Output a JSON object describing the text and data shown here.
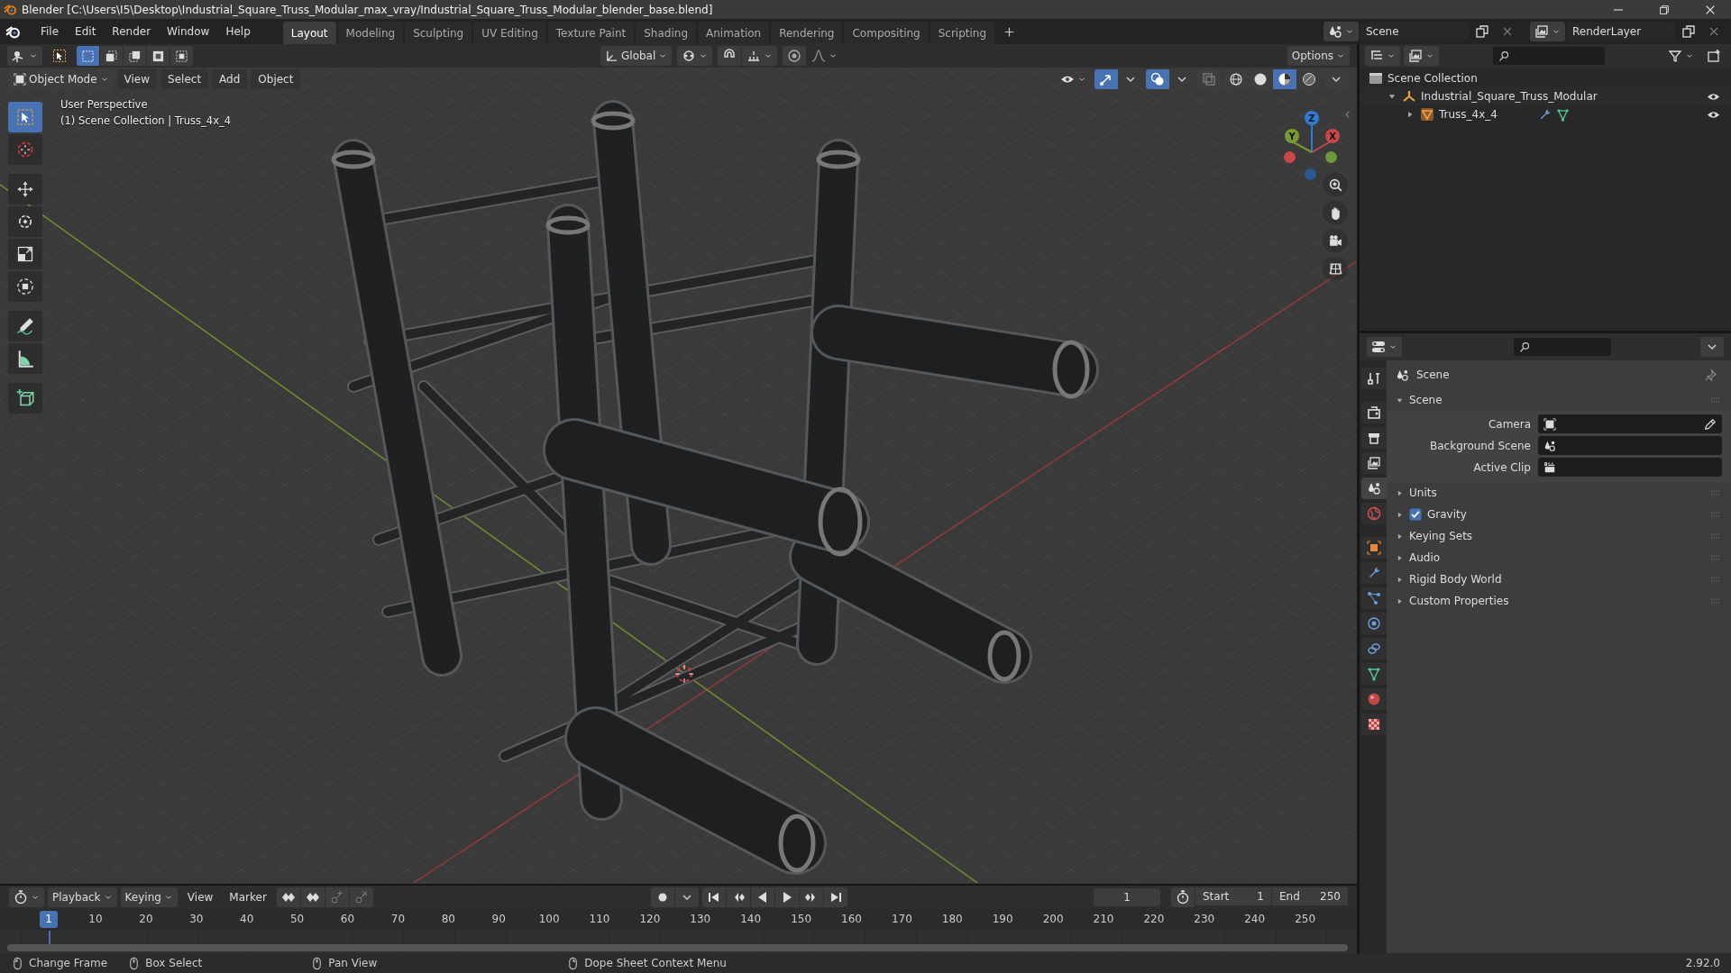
{
  "window": {
    "title": "Blender [C:\\Users\\I5\\Desktop\\Industrial_Square_Truss_Modular_max_vray/Industrial_Square_Truss_Modular_blender_base.blend]"
  },
  "menu": [
    "File",
    "Edit",
    "Render",
    "Window",
    "Help"
  ],
  "workspaces": [
    {
      "label": "Layout",
      "selected": true
    },
    {
      "label": "Modeling",
      "selected": false
    },
    {
      "label": "Sculpting",
      "selected": false
    },
    {
      "label": "UV Editing",
      "selected": false
    },
    {
      "label": "Texture Paint",
      "selected": false
    },
    {
      "label": "Shading",
      "selected": false
    },
    {
      "label": "Animation",
      "selected": false
    },
    {
      "label": "Rendering",
      "selected": false
    },
    {
      "label": "Compositing",
      "selected": false
    },
    {
      "label": "Scripting",
      "selected": false
    }
  ],
  "scene_selector": {
    "value": "Scene"
  },
  "view_layer_selector": {
    "value": "RenderLayer"
  },
  "viewport": {
    "select_modes": [
      {
        "selected": true
      },
      {
        "selected": false
      },
      {
        "selected": false
      },
      {
        "selected": false
      },
      {
        "selected": false
      }
    ],
    "orientation": "Global",
    "options": "Options",
    "mode": "Object Mode",
    "menus": [
      "View",
      "Select",
      "Add",
      "Object"
    ],
    "toggles": [
      {
        "kind": "gizmos",
        "on": true
      },
      {
        "kind": "overlays",
        "on": true
      },
      {
        "kind": "xray",
        "on": false
      }
    ],
    "shading": [
      {
        "selected": false
      },
      {
        "selected": false
      },
      {
        "selected": true
      },
      {
        "selected": false
      }
    ],
    "overlay_lines": [
      "User Perspective",
      "(1) Scene Collection | Truss_4x_4"
    ],
    "tools": [
      {
        "kind": "select",
        "selected": true
      },
      {
        "kind": "cursor",
        "selected": false
      },
      {
        "kind": "move",
        "selected": false
      },
      {
        "kind": "rotate",
        "selected": false
      },
      {
        "kind": "scale",
        "selected": false
      },
      {
        "kind": "transform",
        "selected": false
      },
      {
        "kind": "annotate",
        "selected": false
      },
      {
        "kind": "measure",
        "selected": false
      },
      {
        "kind": "add_cube",
        "selected": false
      }
    ],
    "gizmo_axes": [
      "Z",
      "X",
      "Y"
    ]
  },
  "outliner": {
    "items": [
      {
        "kind": "scene_collection",
        "label": "Scene Collection",
        "children": [
          {
            "kind": "collection",
            "label": "Industrial_Square_Truss_Modular",
            "expanded": true,
            "visible": true,
            "children": [
              {
                "kind": "mesh",
                "label": "Truss_4x_4",
                "expanded": false,
                "visible": true
              }
            ]
          }
        ]
      }
    ]
  },
  "properties": {
    "tabs": [
      {
        "kind": "tool",
        "selected": false
      },
      {
        "kind": "render",
        "selected": false
      },
      {
        "kind": "output",
        "selected": false
      },
      {
        "kind": "view_layer",
        "selected": false
      },
      {
        "kind": "scene",
        "selected": true
      },
      {
        "kind": "world",
        "selected": false
      },
      {
        "kind": "object",
        "selected": false
      },
      {
        "kind": "modifiers",
        "selected": false
      },
      {
        "kind": "particles",
        "selected": false
      },
      {
        "kind": "physics",
        "selected": false
      },
      {
        "kind": "constraints",
        "selected": false
      },
      {
        "kind": "data",
        "selected": false
      },
      {
        "kind": "material",
        "selected": false
      },
      {
        "kind": "texture",
        "selected": false
      }
    ],
    "context": "Scene",
    "panels": [
      {
        "kind": "plain",
        "label": "Scene",
        "expanded": true,
        "fields": [
          {
            "kind": "camera",
            "label": "Camera"
          },
          {
            "kind": "scene",
            "label": "Background Scene"
          },
          {
            "kind": "clip",
            "label": "Active Clip"
          }
        ]
      },
      {
        "kind": "plain",
        "label": "Units",
        "expanded": false
      },
      {
        "kind": "checkbox",
        "label": "Gravity",
        "expanded": false,
        "checked": true
      },
      {
        "kind": "plain",
        "label": "Keying Sets",
        "expanded": false
      },
      {
        "kind": "plain",
        "label": "Audio",
        "expanded": false
      },
      {
        "kind": "plain",
        "label": "Rigid Body World",
        "expanded": false
      },
      {
        "kind": "plain",
        "label": "Custom Properties",
        "expanded": false
      }
    ]
  },
  "timeline": {
    "menus": [
      "Playback",
      "Keying",
      "View",
      "Marker"
    ],
    "current_frame": "1",
    "start": {
      "label": "Start",
      "value": "1"
    },
    "end": {
      "label": "End",
      "value": "250"
    },
    "playhead": "1",
    "ruler": [
      "10",
      "20",
      "30",
      "40",
      "50",
      "60",
      "70",
      "80",
      "90",
      "100",
      "110",
      "120",
      "130",
      "140",
      "150",
      "160",
      "170",
      "180",
      "190",
      "200",
      "210",
      "220",
      "230",
      "240",
      "250"
    ]
  },
  "status_bar": {
    "hints": [
      "Change Frame",
      "Box Select",
      "Pan View",
      "Dope Sheet Context Menu"
    ],
    "version": "2.92.0"
  }
}
